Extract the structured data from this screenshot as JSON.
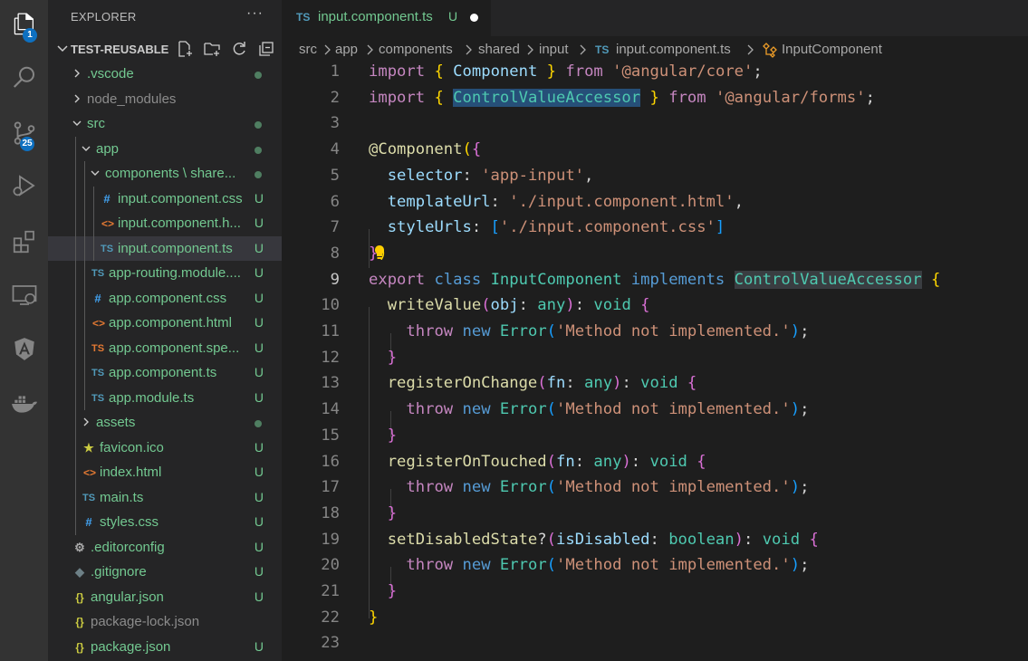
{
  "activity_bar": {
    "items": [
      {
        "name": "explorer-icon",
        "badge": "1"
      },
      {
        "name": "search-icon",
        "badge": ""
      },
      {
        "name": "source-control-icon",
        "badge": "25"
      },
      {
        "name": "run-debug-icon",
        "badge": ""
      },
      {
        "name": "extensions-icon",
        "badge": ""
      },
      {
        "name": "remote-explorer-icon",
        "badge": ""
      },
      {
        "name": "angular-icon",
        "badge": ""
      },
      {
        "name": "docker-icon",
        "badge": ""
      }
    ]
  },
  "sidebar": {
    "title": "EXPLORER",
    "more": "···",
    "section": "TEST-REUSABLE",
    "tree": [
      {
        "label": ".vscode",
        "kind": "folder-closed",
        "depth": 0,
        "status": "dot",
        "color": "#73c991"
      },
      {
        "label": "node_modules",
        "kind": "folder-closed",
        "depth": 0,
        "status": "",
        "color": "#8c8c8c"
      },
      {
        "label": "src",
        "kind": "folder-open",
        "depth": 0,
        "status": "dot",
        "color": "#73c991"
      },
      {
        "label": "app",
        "kind": "folder-open",
        "depth": 1,
        "status": "dot",
        "color": "#73c991"
      },
      {
        "label": "components \\ share...",
        "kind": "folder-open",
        "depth": 2,
        "status": "dot",
        "color": "#73c991"
      },
      {
        "label": "input.component.css",
        "kind": "css",
        "depth": 3,
        "status": "U",
        "color": "#73c991"
      },
      {
        "label": "input.component.h...",
        "kind": "html",
        "depth": 3,
        "status": "U",
        "color": "#73c991"
      },
      {
        "label": "input.component.ts",
        "kind": "ts",
        "depth": 3,
        "status": "U",
        "color": "#73c991",
        "selected": true
      },
      {
        "label": "app-routing.module....",
        "kind": "ts",
        "depth": 2,
        "status": "U",
        "color": "#73c991"
      },
      {
        "label": "app.component.css",
        "kind": "css",
        "depth": 2,
        "status": "U",
        "color": "#73c991"
      },
      {
        "label": "app.component.html",
        "kind": "html",
        "depth": 2,
        "status": "U",
        "color": "#73c991"
      },
      {
        "label": "app.component.spe...",
        "kind": "ts-spec",
        "depth": 2,
        "status": "U",
        "color": "#73c991"
      },
      {
        "label": "app.component.ts",
        "kind": "ts",
        "depth": 2,
        "status": "U",
        "color": "#73c991"
      },
      {
        "label": "app.module.ts",
        "kind": "ts",
        "depth": 2,
        "status": "U",
        "color": "#73c991"
      },
      {
        "label": "assets",
        "kind": "folder-closed",
        "depth": 1,
        "status": "dot",
        "color": "#73c991"
      },
      {
        "label": "favicon.ico",
        "kind": "star",
        "depth": 1,
        "status": "U",
        "color": "#73c991"
      },
      {
        "label": "index.html",
        "kind": "html",
        "depth": 1,
        "status": "U",
        "color": "#73c991"
      },
      {
        "label": "main.ts",
        "kind": "ts",
        "depth": 1,
        "status": "U",
        "color": "#73c991"
      },
      {
        "label": "styles.css",
        "kind": "css",
        "depth": 1,
        "status": "U",
        "color": "#73c991"
      },
      {
        "label": ".editorconfig",
        "kind": "gear",
        "depth": 0,
        "status": "U",
        "color": "#73c991"
      },
      {
        "label": ".gitignore",
        "kind": "git",
        "depth": 0,
        "status": "U",
        "color": "#73c991"
      },
      {
        "label": "angular.json",
        "kind": "json",
        "depth": 0,
        "status": "U",
        "color": "#73c991"
      },
      {
        "label": "package-lock.json",
        "kind": "json",
        "depth": 0,
        "status": "",
        "color": "#8c8c8c"
      },
      {
        "label": "package.json",
        "kind": "json",
        "depth": 0,
        "status": "U",
        "color": "#73c991"
      }
    ]
  },
  "tab": {
    "lang": "TS",
    "name": "input.component.ts",
    "status": "U"
  },
  "breadcrumb": {
    "parts": [
      "src",
      "app",
      "components",
      "shared",
      "input"
    ],
    "file_lang": "TS",
    "file": "input.component.ts",
    "symbol": "InputComponent"
  },
  "editor": {
    "current_line": 9,
    "lines": [
      {
        "n": "1",
        "indent": 0,
        "tokens": [
          [
            "k",
            "import"
          ],
          [
            "p",
            " "
          ],
          [
            "b1",
            "{"
          ],
          [
            "p",
            " "
          ],
          [
            "v",
            "Component"
          ],
          [
            "p",
            " "
          ],
          [
            "b1",
            "}"
          ],
          [
            "p",
            " "
          ],
          [
            "k",
            "from"
          ],
          [
            "p",
            " "
          ],
          [
            "s",
            "'@angular/core'"
          ],
          [
            "p",
            ";"
          ]
        ]
      },
      {
        "n": "2",
        "indent": 0,
        "tokens": [
          [
            "k",
            "import"
          ],
          [
            "p",
            " "
          ],
          [
            "b1",
            "{"
          ],
          [
            "p",
            " "
          ],
          [
            "c hl",
            "ControlValueAccessor"
          ],
          [
            "p",
            " "
          ],
          [
            "b1",
            "}"
          ],
          [
            "p",
            " "
          ],
          [
            "k",
            "from"
          ],
          [
            "p",
            " "
          ],
          [
            "s",
            "'@angular/forms'"
          ],
          [
            "p",
            ";"
          ]
        ]
      },
      {
        "n": "3",
        "indent": 0,
        "tokens": []
      },
      {
        "n": "4",
        "indent": 0,
        "tokens": [
          [
            "f",
            "@Component"
          ],
          [
            "b1",
            "("
          ],
          [
            "b2",
            "{"
          ]
        ]
      },
      {
        "n": "5",
        "indent": 1,
        "tokens": [
          [
            "p",
            "  "
          ],
          [
            "v",
            "selector"
          ],
          [
            "p",
            ": "
          ],
          [
            "s",
            "'app-input'"
          ],
          [
            "p",
            ","
          ]
        ]
      },
      {
        "n": "6",
        "indent": 1,
        "tokens": [
          [
            "p",
            "  "
          ],
          [
            "v",
            "templateUrl"
          ],
          [
            "p",
            ": "
          ],
          [
            "s",
            "'./input.component.html'"
          ],
          [
            "p",
            ","
          ]
        ]
      },
      {
        "n": "7",
        "indent": 1,
        "tokens": [
          [
            "p",
            "  "
          ],
          [
            "v",
            "styleUrls"
          ],
          [
            "p",
            ": "
          ],
          [
            "b3",
            "["
          ],
          [
            "s",
            "'./input.component.css'"
          ],
          [
            "b3",
            "]"
          ]
        ]
      },
      {
        "n": "8",
        "indent": 0,
        "tokens": [
          [
            "b2",
            "}"
          ],
          [
            "b1",
            ")"
          ]
        ]
      },
      {
        "n": "9",
        "indent": 0,
        "tokens": [
          [
            "k",
            "export"
          ],
          [
            "p",
            " "
          ],
          [
            "kb",
            "class"
          ],
          [
            "p",
            " "
          ],
          [
            "c",
            "InputComponent"
          ],
          [
            "p",
            " "
          ],
          [
            "kb",
            "implements"
          ],
          [
            "p",
            " "
          ],
          [
            "c hl2",
            "ControlValueAccessor"
          ],
          [
            "p",
            " "
          ],
          [
            "b1",
            "{"
          ]
        ]
      },
      {
        "n": "10",
        "indent": 1,
        "tokens": [
          [
            "p",
            "  "
          ],
          [
            "f",
            "writeValue"
          ],
          [
            "b2",
            "("
          ],
          [
            "v",
            "obj"
          ],
          [
            "p",
            ": "
          ],
          [
            "c",
            "any"
          ],
          [
            "b2",
            ")"
          ],
          [
            "p",
            ": "
          ],
          [
            "c",
            "void"
          ],
          [
            "p",
            " "
          ],
          [
            "b2",
            "{"
          ]
        ]
      },
      {
        "n": "11",
        "indent": 2,
        "tokens": [
          [
            "p",
            "    "
          ],
          [
            "k",
            "throw"
          ],
          [
            "p",
            " "
          ],
          [
            "kb",
            "new"
          ],
          [
            "p",
            " "
          ],
          [
            "c",
            "Error"
          ],
          [
            "b3",
            "("
          ],
          [
            "s",
            "'Method not implemented.'"
          ],
          [
            "b3",
            ")"
          ],
          [
            "p",
            ";"
          ]
        ]
      },
      {
        "n": "12",
        "indent": 1,
        "tokens": [
          [
            "p",
            "  "
          ],
          [
            "b2",
            "}"
          ]
        ]
      },
      {
        "n": "13",
        "indent": 1,
        "tokens": [
          [
            "p",
            "  "
          ],
          [
            "f",
            "registerOnChange"
          ],
          [
            "b2",
            "("
          ],
          [
            "v",
            "fn"
          ],
          [
            "p",
            ": "
          ],
          [
            "c",
            "any"
          ],
          [
            "b2",
            ")"
          ],
          [
            "p",
            ": "
          ],
          [
            "c",
            "void"
          ],
          [
            "p",
            " "
          ],
          [
            "b2",
            "{"
          ]
        ]
      },
      {
        "n": "14",
        "indent": 2,
        "tokens": [
          [
            "p",
            "    "
          ],
          [
            "k",
            "throw"
          ],
          [
            "p",
            " "
          ],
          [
            "kb",
            "new"
          ],
          [
            "p",
            " "
          ],
          [
            "c",
            "Error"
          ],
          [
            "b3",
            "("
          ],
          [
            "s",
            "'Method not implemented.'"
          ],
          [
            "b3",
            ")"
          ],
          [
            "p",
            ";"
          ]
        ]
      },
      {
        "n": "15",
        "indent": 1,
        "tokens": [
          [
            "p",
            "  "
          ],
          [
            "b2",
            "}"
          ]
        ]
      },
      {
        "n": "16",
        "indent": 1,
        "tokens": [
          [
            "p",
            "  "
          ],
          [
            "f",
            "registerOnTouched"
          ],
          [
            "b2",
            "("
          ],
          [
            "v",
            "fn"
          ],
          [
            "p",
            ": "
          ],
          [
            "c",
            "any"
          ],
          [
            "b2",
            ")"
          ],
          [
            "p",
            ": "
          ],
          [
            "c",
            "void"
          ],
          [
            "p",
            " "
          ],
          [
            "b2",
            "{"
          ]
        ]
      },
      {
        "n": "17",
        "indent": 2,
        "tokens": [
          [
            "p",
            "    "
          ],
          [
            "k",
            "throw"
          ],
          [
            "p",
            " "
          ],
          [
            "kb",
            "new"
          ],
          [
            "p",
            " "
          ],
          [
            "c",
            "Error"
          ],
          [
            "b3",
            "("
          ],
          [
            "s",
            "'Method not implemented.'"
          ],
          [
            "b3",
            ")"
          ],
          [
            "p",
            ";"
          ]
        ]
      },
      {
        "n": "18",
        "indent": 1,
        "tokens": [
          [
            "p",
            "  "
          ],
          [
            "b2",
            "}"
          ]
        ]
      },
      {
        "n": "19",
        "indent": 1,
        "tokens": [
          [
            "p",
            "  "
          ],
          [
            "f",
            "setDisabledState"
          ],
          [
            "p",
            "?"
          ],
          [
            "b2",
            "("
          ],
          [
            "v",
            "isDisabled"
          ],
          [
            "p",
            ": "
          ],
          [
            "c",
            "boolean"
          ],
          [
            "b2",
            ")"
          ],
          [
            "p",
            ": "
          ],
          [
            "c",
            "void"
          ],
          [
            "p",
            " "
          ],
          [
            "b2",
            "{"
          ]
        ]
      },
      {
        "n": "20",
        "indent": 2,
        "tokens": [
          [
            "p",
            "    "
          ],
          [
            "k",
            "throw"
          ],
          [
            "p",
            " "
          ],
          [
            "kb",
            "new"
          ],
          [
            "p",
            " "
          ],
          [
            "c",
            "Error"
          ],
          [
            "b3",
            "("
          ],
          [
            "s",
            "'Method not implemented.'"
          ],
          [
            "b3",
            ")"
          ],
          [
            "p",
            ";"
          ]
        ]
      },
      {
        "n": "21",
        "indent": 1,
        "tokens": [
          [
            "p",
            "  "
          ],
          [
            "b2",
            "}"
          ]
        ]
      },
      {
        "n": "22",
        "indent": 0,
        "tokens": [
          [
            "b1",
            "}"
          ]
        ]
      },
      {
        "n": "23",
        "indent": 0,
        "tokens": []
      }
    ]
  }
}
